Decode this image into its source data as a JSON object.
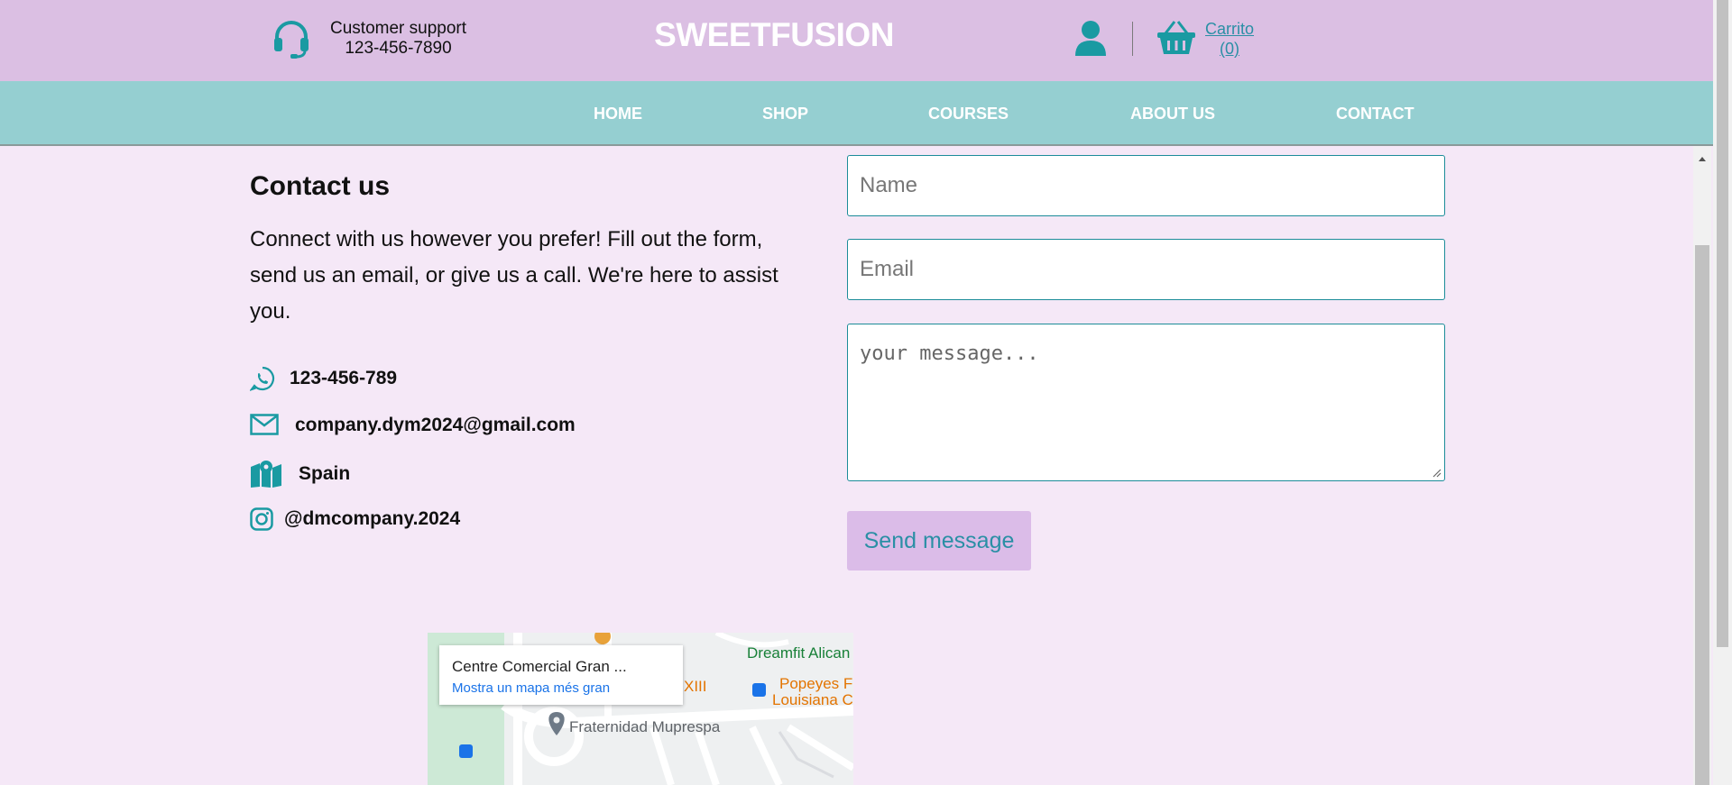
{
  "header": {
    "support_label": "Customer support",
    "support_phone": "123-456-7890",
    "brand": "SWEETFUSION",
    "cart_label": "Carrito",
    "cart_count": "(0)"
  },
  "nav": {
    "items": [
      "HOME",
      "SHOP",
      "COURSES",
      "ABOUT US",
      "CONTACT"
    ]
  },
  "contact": {
    "title": "Contact us",
    "description": "Connect with us however you prefer! Fill out the form, send us an email, or give us a call. We're here to assist you.",
    "phone": "123-456-789",
    "email": "company.dym2024@gmail.com",
    "location": "Spain",
    "instagram": "@dmcompany.2024"
  },
  "form": {
    "name_placeholder": "Name",
    "email_placeholder": "Email",
    "message_placeholder": "your message...",
    "send_label": "Send message"
  },
  "map": {
    "place_name": "Centre Comercial Gran ...",
    "bigger_map_link": "Mostra un mapa més gran",
    "labels": [
      "Dreamfit Alican",
      "Popeyes F",
      "Louisiana C",
      "XIII",
      "Fraternidad Muprespa"
    ]
  },
  "colors": {
    "topbar": "#dbbfe3",
    "nav": "#95cfd1",
    "page_bg": "#f5e8f7",
    "accent_teal": "#1c8c99",
    "button_bg": "#dbbce8"
  },
  "icons": [
    "headset-icon",
    "user-icon",
    "basket-icon",
    "whatsapp-icon",
    "mail-icon",
    "map-icon",
    "instagram-icon"
  ]
}
